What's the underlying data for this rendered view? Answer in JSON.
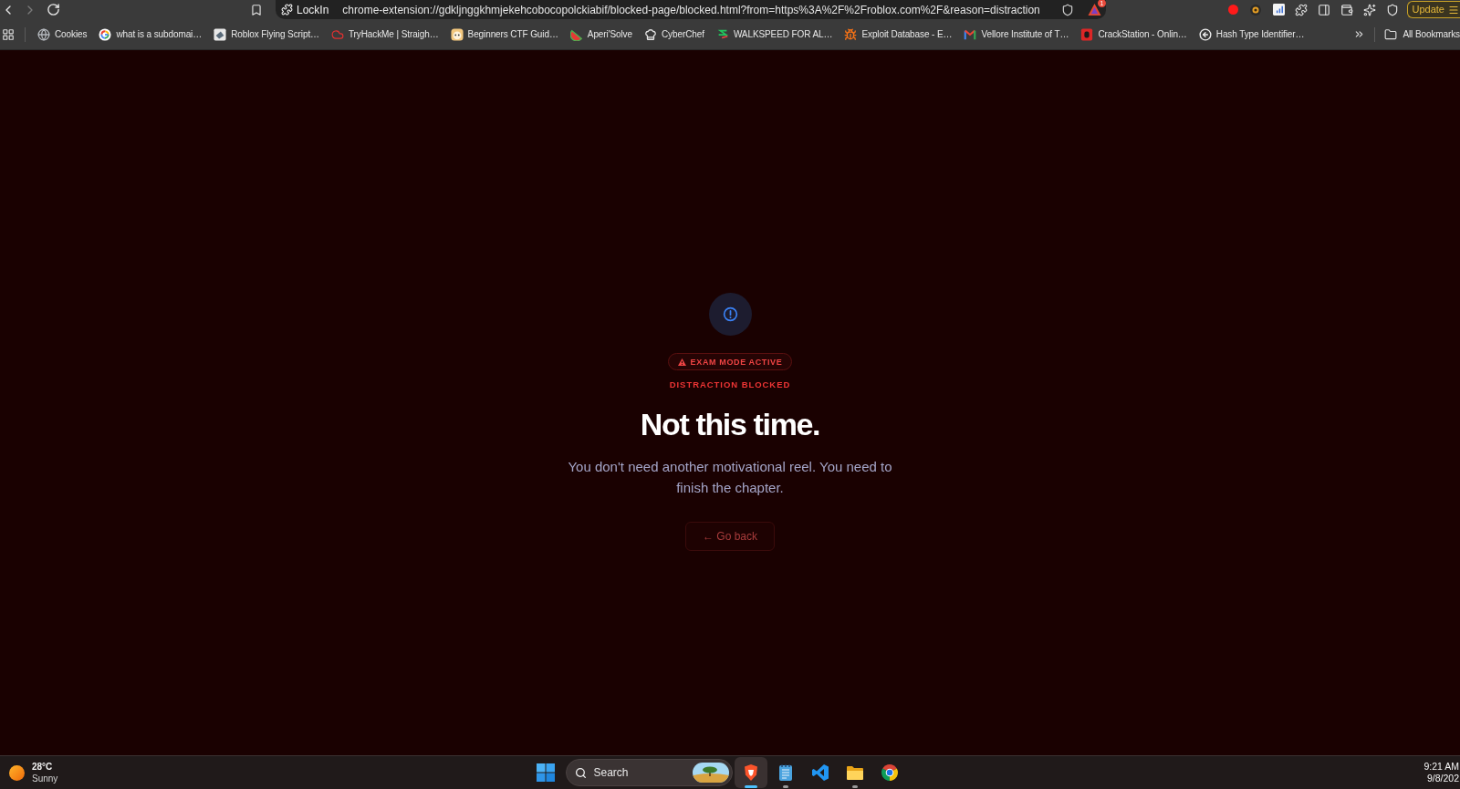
{
  "toolbar": {
    "back": {
      "disabled": false
    },
    "forward": {
      "disabled": true
    },
    "site_label": "LockIn",
    "url": "chrome-extension://gdkljnggkhmjekehcobocopolckiabif/blocked-page/blocked.html?from=https%3A%2F%2Froblox.com%2F&reason=distraction",
    "rewards_badge": "1",
    "update_button": "Update"
  },
  "bookmarks_bar": {
    "items": [
      {
        "label": "Cookies"
      },
      {
        "label": "what is a subdomai…"
      },
      {
        "label": "Roblox Flying Script…"
      },
      {
        "label": "TryHackMe | Straigh…"
      },
      {
        "label": "Beginners CTF Guid…"
      },
      {
        "label": "Aperi'Solve"
      },
      {
        "label": "CyberChef"
      },
      {
        "label": "WALKSPEED FOR AL…"
      },
      {
        "label": "Exploit Database - E…"
      },
      {
        "label": "Vellore Institute of T…"
      },
      {
        "label": "CrackStation - Onlin…"
      },
      {
        "label": "Hash Type Identifier…"
      }
    ],
    "all_bookmarks": "All Bookmarks"
  },
  "page": {
    "badge": "EXAM MODE ACTIVE",
    "eyebrow": "DISTRACTION BLOCKED",
    "heading": "Not this time.",
    "message": "You don't need another motivational reel. You need to finish the chapter.",
    "back_button": "← Go back"
  },
  "taskbar": {
    "weather": {
      "temperature": "28°C",
      "condition": "Sunny"
    },
    "search": {
      "placeholder": "Search"
    },
    "apps": [
      {
        "open": true,
        "selected": true
      },
      {
        "open": true,
        "selected": false
      },
      {
        "open": false,
        "selected": false
      },
      {
        "open": true,
        "selected": false
      },
      {
        "open": false,
        "selected": false
      }
    ],
    "clock": {
      "time": "9:21 AM",
      "date": "9/8/202"
    }
  }
}
